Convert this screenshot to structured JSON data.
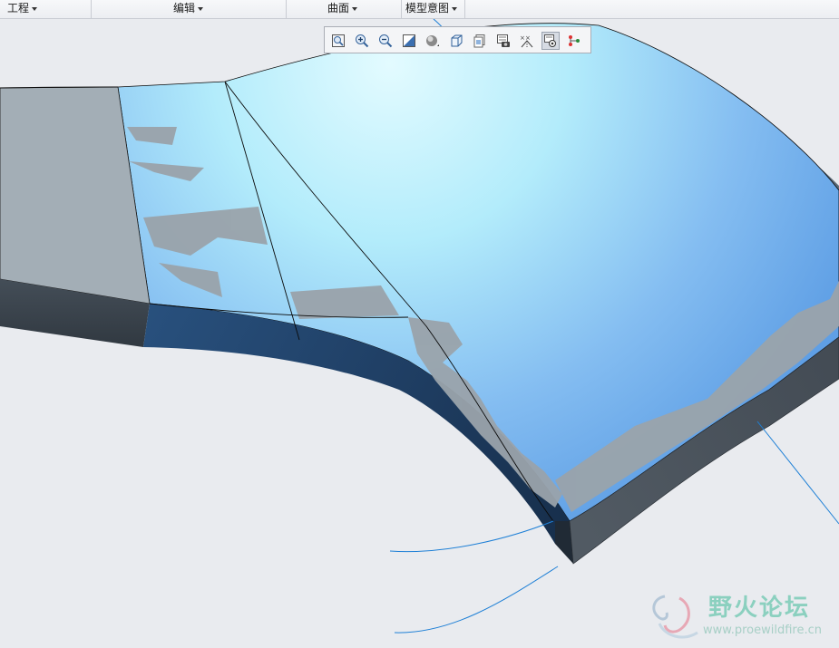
{
  "menubar": {
    "items": [
      {
        "label": "工程"
      },
      {
        "label": "编辑"
      },
      {
        "label": "曲面"
      },
      {
        "label": "模型意图"
      }
    ]
  },
  "toolbar": {
    "buttons": [
      {
        "icon": "zoom-fit-icon"
      },
      {
        "icon": "zoom-in-icon"
      },
      {
        "icon": "zoom-out-icon"
      },
      {
        "icon": "reorient-icon"
      },
      {
        "icon": "shading-style-icon"
      },
      {
        "icon": "view-cube-icon"
      },
      {
        "icon": "saved-views-icon"
      },
      {
        "icon": "appearance-icon"
      },
      {
        "icon": "datum-display-icon"
      },
      {
        "icon": "spin-center-icon",
        "active": true
      },
      {
        "icon": "annotation-display-icon"
      }
    ]
  },
  "watermark": {
    "title": "野火论坛",
    "url": "www.proewildfire.cn"
  },
  "colors": {
    "face_blue_light": "#e3fbff",
    "face_blue_dark": "#5f9fe5",
    "side_face_dark": "#1e3c60",
    "grey_face": "#a3aeb6",
    "background": "#e9ebef"
  }
}
